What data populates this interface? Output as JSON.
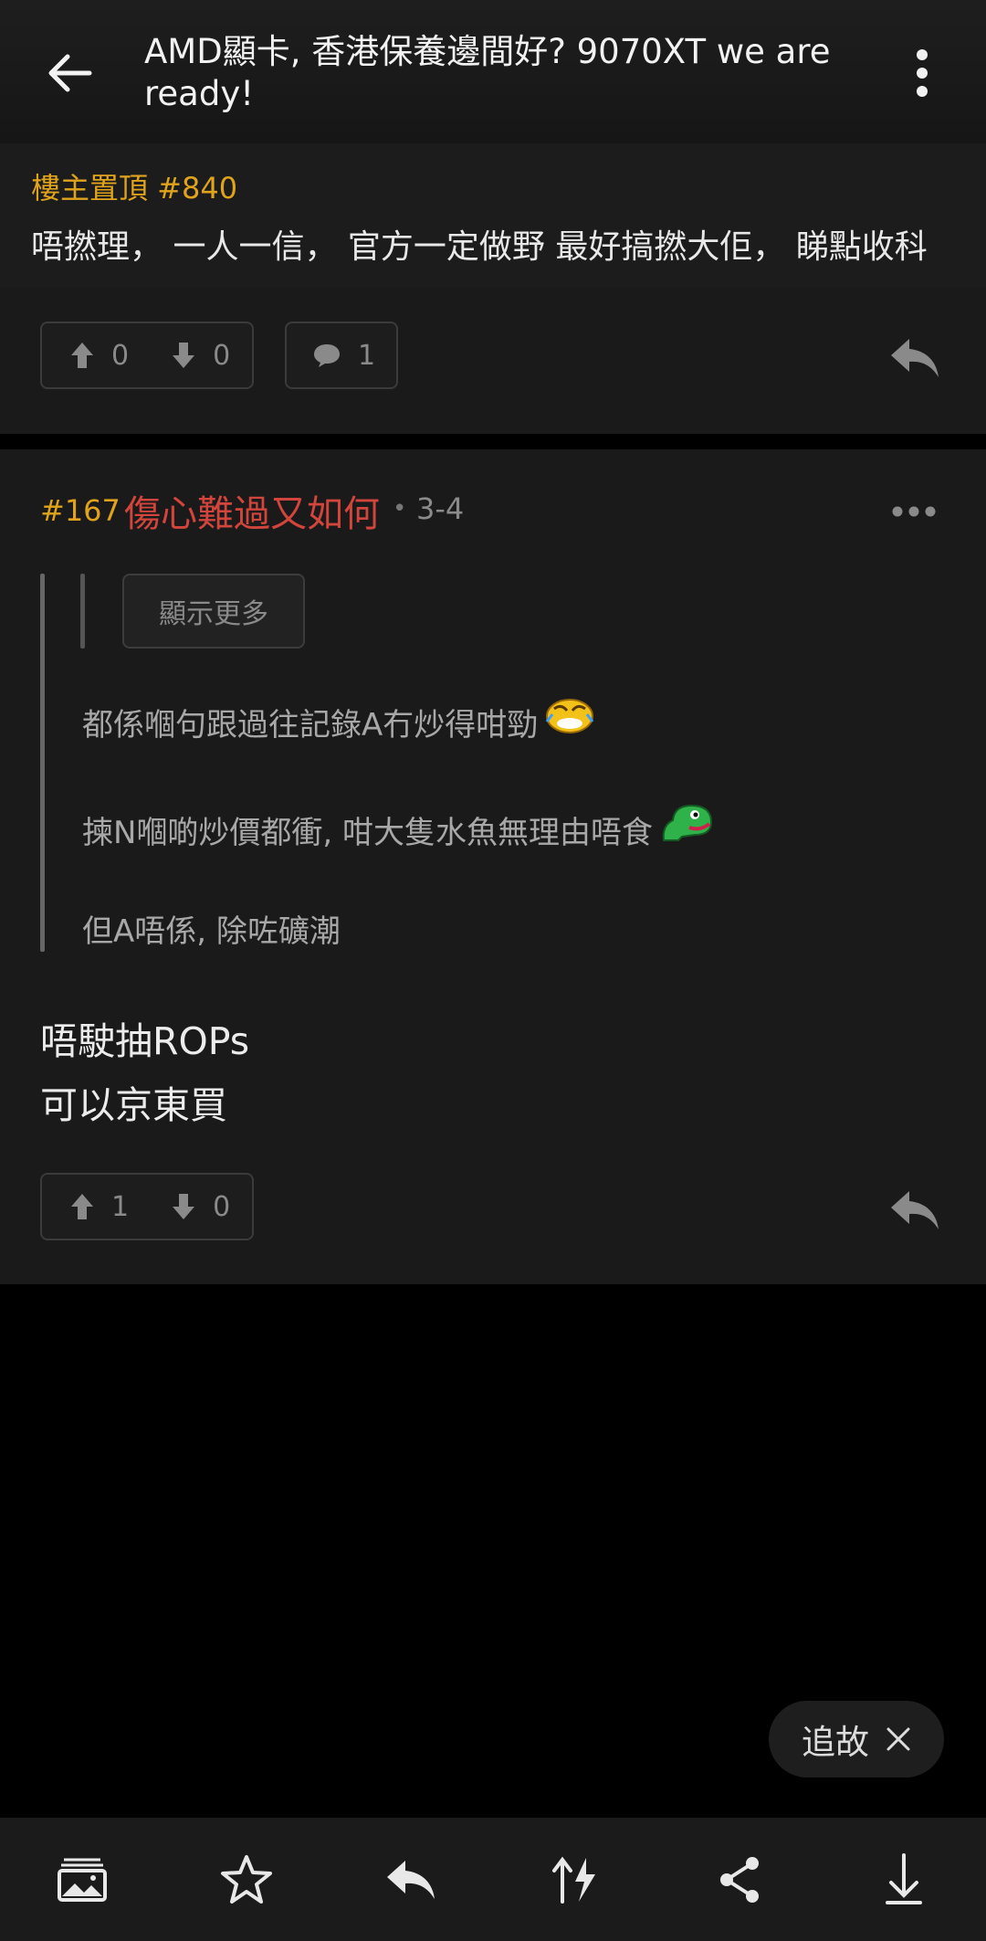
{
  "header": {
    "title": "AMD顯卡, 香港保養邊間好? 9070XT we are ready!",
    "back_icon": "arrow-left-icon",
    "more_icon": "more-vertical-icon"
  },
  "pinned": {
    "label": "樓主置頂 #840",
    "text": "唔撚理， 一人一信， 官方一定做野 最好搞撚大佢， 睇點收科",
    "upvotes": "0",
    "downvotes": "0",
    "comments": "1"
  },
  "post": {
    "number": "#167",
    "username": "傷心難過又如何",
    "separator": "•",
    "date": "3-4",
    "show_more": "顯示更多",
    "quote_lines": [
      "都係嗰句跟過往記錄A冇炒得咁勁",
      "揀N嗰啲炒價都衝, 咁大隻水魚無理由唔食",
      "但A唔係, 除咗礦潮"
    ],
    "body_lines": [
      "唔駛抽ROPs",
      "可以京東買"
    ],
    "upvotes": "1",
    "downvotes": "0"
  },
  "fab": {
    "label": "追故"
  },
  "bottom_bar": {
    "icons": [
      "image-icon",
      "star-icon",
      "reply-icon",
      "sort-flash-icon",
      "share-icon",
      "download-icon"
    ]
  },
  "colors": {
    "accent_orange": "#e0a31c",
    "username_red": "#d2453c",
    "background": "#000000",
    "card": "#1a1a1a"
  }
}
